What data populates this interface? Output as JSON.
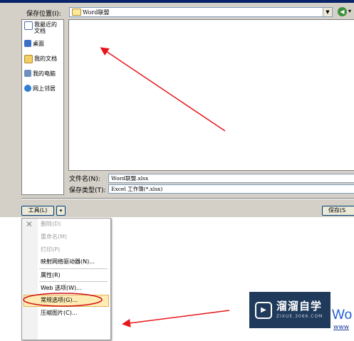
{
  "dialog": {
    "save_location_label": "保存位置(I):",
    "save_location_value": "Word联盟",
    "places": [
      {
        "label": "我最近的文档",
        "icon": "recent-docs-icon"
      },
      {
        "label": "桌面",
        "icon": "desktop-icon"
      },
      {
        "label": "我的文档",
        "icon": "my-documents-icon"
      },
      {
        "label": "我的电脑",
        "icon": "my-computer-icon"
      },
      {
        "label": "网上邻居",
        "icon": "network-places-icon"
      }
    ],
    "filename_label": "文件名(N):",
    "filename_value": "Word联盟.xlsx",
    "filetype_label": "保存类型(T):",
    "filetype_value": "Excel 工作簿(*.xlsx)",
    "tools_label": "工具(L)",
    "save_label": "保存(S"
  },
  "tools_menu": {
    "items": [
      {
        "label": "删除(D)",
        "enabled": false
      },
      {
        "label": "重命名(M)",
        "enabled": false
      },
      {
        "label": "打印(P)",
        "enabled": false
      },
      {
        "label": "映射网络驱动器(N)...",
        "enabled": true
      },
      {
        "label": "属性(R)",
        "enabled": true
      },
      {
        "label": "Web 选项(W)...",
        "enabled": true
      },
      {
        "label": "常规选项(G)...",
        "enabled": true
      },
      {
        "label": "压缩图片(C)...",
        "enabled": true
      }
    ]
  },
  "watermark": {
    "brand": "溜溜自学",
    "url": "ZIXUE.3066.COM",
    "partial_text": "Wo",
    "partial_url": "www"
  },
  "colors": {
    "dialog_bg": "#d4d0c8",
    "annotation_red": "#e8151b",
    "highlight_oval": "#d01010",
    "logo_bg": "#1f3a5a"
  }
}
